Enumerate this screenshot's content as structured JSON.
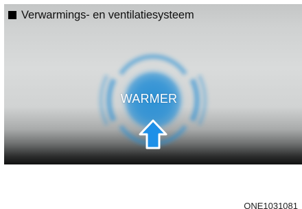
{
  "header": {
    "title": "Verwarmings- en ventilatiesysteem"
  },
  "illustration": {
    "button_label": "WARMER",
    "arrow_icon": "up-arrow-icon",
    "glow_color": "#2a8fd6",
    "arrow_color": "#1e90e8"
  },
  "footer": {
    "figure_code": "ONE1031081"
  }
}
